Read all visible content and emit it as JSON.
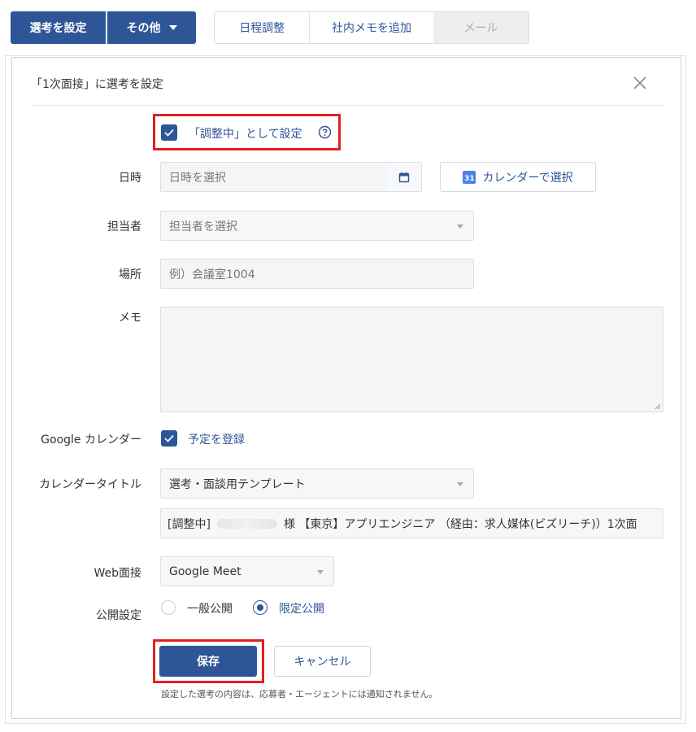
{
  "toolbar": {
    "set_selection": "選考を設定",
    "other": "その他",
    "schedule": "日程調整",
    "internal_memo": "社内メモを追加",
    "mail": "メール"
  },
  "panel": {
    "title": "「1次面接」に選考を設定",
    "adjusting_checkbox_label": "「調整中」として設定"
  },
  "form": {
    "datetime_label": "日時",
    "datetime_placeholder": "日時を選択",
    "calendar_select_button": "カレンダーで選択",
    "calendar_icon_text": "31",
    "owner_label": "担当者",
    "owner_placeholder": "担当者を選択",
    "place_label": "場所",
    "place_placeholder": "例）会議室1004",
    "memo_label": "メモ",
    "gcal_label": "Google カレンダー",
    "gcal_checkbox_label": "予定を登録",
    "cal_title_label": "カレンダータイトル",
    "cal_title_template": "選考・面談用テンプレート",
    "cal_title_prefix": "[調整中]",
    "cal_title_suffix": "様 【東京】アプリエンジニア （経由：求人媒体(ビズリーチ)）1次面",
    "web_interview_label": "Web面接",
    "web_interview_value": "Google Meet",
    "publish_label": "公開設定",
    "publish_general": "一般公開",
    "publish_limited": "限定公開",
    "publish_selected": "限定公開"
  },
  "actions": {
    "save": "保存",
    "cancel": "キャンセル",
    "note": "設定した選考の内容は、応募者・エージェントには通知されません。"
  },
  "colors": {
    "primary": "#2d5597",
    "highlight": "#e02020"
  }
}
